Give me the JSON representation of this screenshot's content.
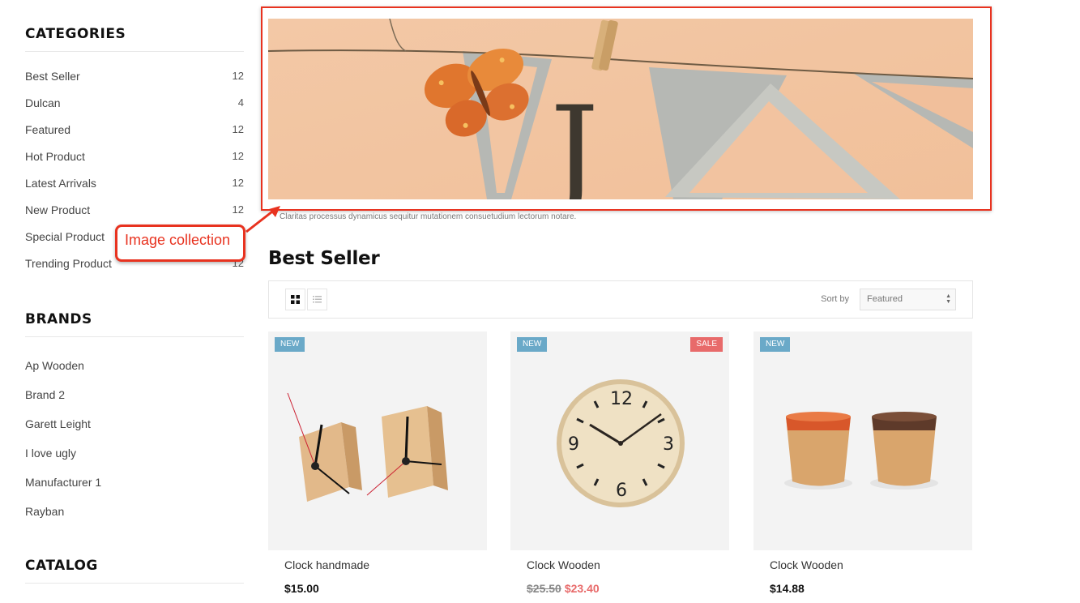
{
  "sidebar": {
    "categories": {
      "heading": "CATEGORIES",
      "items": [
        {
          "label": "Best Seller",
          "count": "12"
        },
        {
          "label": "Dulcan",
          "count": "4"
        },
        {
          "label": "Featured",
          "count": "12"
        },
        {
          "label": "Hot Product",
          "count": "12"
        },
        {
          "label": "Latest Arrivals",
          "count": "12"
        },
        {
          "label": "New Product",
          "count": "12"
        },
        {
          "label": "Special Product",
          "count": "12"
        },
        {
          "label": "Trending Product",
          "count": "12"
        }
      ]
    },
    "brands": {
      "heading": "BRANDS",
      "items": [
        "Ap Wooden",
        "Brand 2",
        "Garett Leight",
        "I love ugly",
        "Manufacturer 1",
        "Rayban"
      ]
    },
    "catalog": {
      "heading": "CATALOG"
    }
  },
  "banner": {
    "letter": "J",
    "caption": "Claritas processus dynamicus sequitur mutationem consuetudium lectorum notare."
  },
  "annotation": {
    "callout": "Image collection",
    "color": "#e8321f"
  },
  "section": {
    "title": "Best Seller"
  },
  "toolbar": {
    "grid_icon": "grid-view-icon",
    "list_icon": "list-view-icon",
    "sort_label": "Sort by",
    "sort_value": "Featured"
  },
  "products": [
    {
      "name": "Clock handmade",
      "price": "$15.00",
      "badge": "NEW"
    },
    {
      "name": "Clock Wooden",
      "old_price": "$25.50",
      "price": "$23.40",
      "badge": "NEW",
      "badge2": "SALE"
    },
    {
      "name": "Clock Wooden",
      "price": "$14.88",
      "badge": "NEW"
    }
  ],
  "colors": {
    "new_badge": "#6aa9c8",
    "sale_badge": "#e86a6a",
    "sale_price": "#e86a6a"
  }
}
